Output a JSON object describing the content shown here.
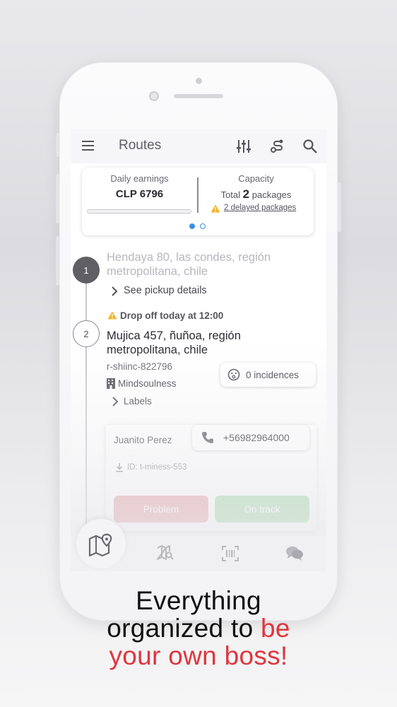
{
  "appbar": {
    "title": "Routes"
  },
  "summary": {
    "earnings_label": "Daily earnings",
    "earnings_value": "CLP 6796",
    "capacity_label": "Capacity",
    "capacity_prefix": "Total",
    "capacity_count": "2",
    "capacity_suffix": "packages",
    "delayed_link": "2 delayed packages"
  },
  "stops": [
    {
      "number": "1",
      "address": "Hendaya 80, las condes, región metropolitana, chile",
      "details_link": "See pickup details"
    },
    {
      "number": "2",
      "warning": "Drop off today at 12:00",
      "address": "Mujica 457, ñuñoa, región metropolitana, chile",
      "code": "r-shiinc-822796",
      "company": "Mindsoulness",
      "incidences": "0 incidences",
      "labels_link": "Labels",
      "contact_name": "Juanito Perez",
      "phone": "+56982964000",
      "package_id": "ID: t-miness-553",
      "problem_button": "Problem",
      "ontrack_button": "On track"
    }
  ],
  "colors": {
    "problem": "#e8a2a5",
    "ontrack": "#a3dba8",
    "warning": "#f2b42a",
    "accent_dot": "#3d8ee6"
  },
  "tagline": {
    "line1": "Everything",
    "line2_black": "organized to ",
    "line2_red": "be",
    "line3_red": "your own boss!"
  }
}
